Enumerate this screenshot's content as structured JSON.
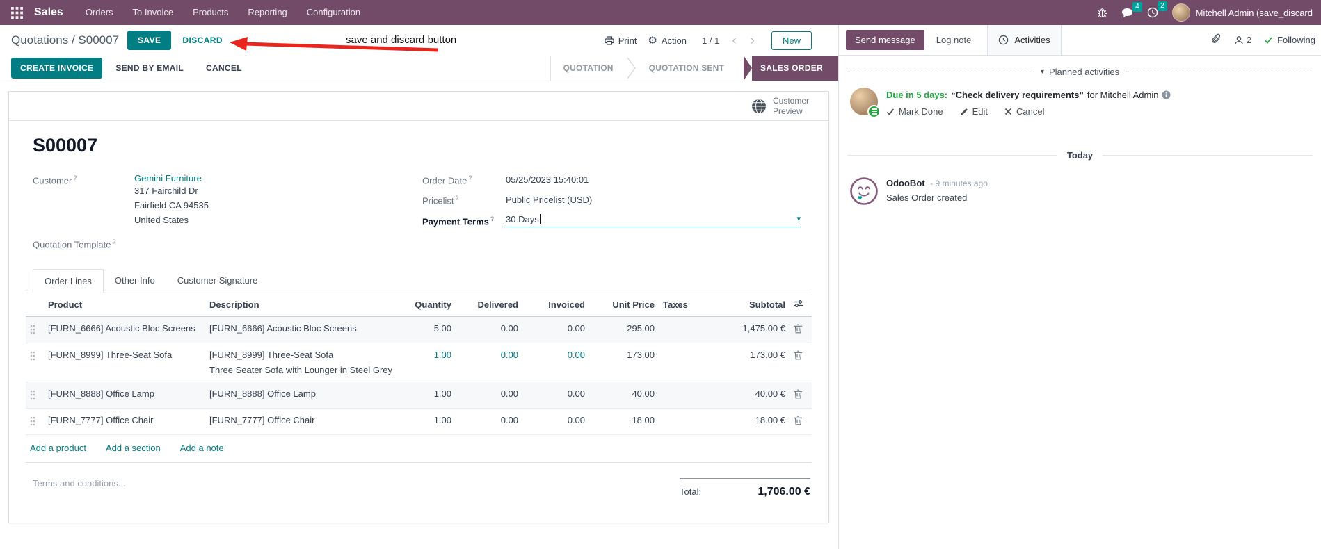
{
  "colors": {
    "brand": "#714B67",
    "accent": "#017E84",
    "badge": "#00A09D",
    "success": "#28a745",
    "arrow_red": "#e8261d"
  },
  "nav": {
    "app": "Sales",
    "items": [
      "Orders",
      "To Invoice",
      "Products",
      "Reporting",
      "Configuration"
    ],
    "badges": {
      "messages": "4",
      "activities": "2"
    },
    "user": "Mitchell Admin (save_discard"
  },
  "control": {
    "breadcrumb_parent": "Quotations",
    "breadcrumb_sep": " / ",
    "breadcrumb_current": "S00007",
    "save": "SAVE",
    "discard": "DISCARD",
    "print": "Print",
    "action": "Action",
    "pager": "1 / 1",
    "prev": "‹",
    "next": "›",
    "new": "New"
  },
  "annotation": {
    "text": "save and discard button"
  },
  "statusbar": {
    "create_invoice": "CREATE INVOICE",
    "send_by_email": "SEND BY EMAIL",
    "cancel": "CANCEL",
    "states": [
      "QUOTATION",
      "QUOTATION SENT"
    ],
    "active_state": "SALES ORDER"
  },
  "sheet": {
    "preview": "Customer Preview",
    "title": "S00007",
    "help": "?",
    "customer_label": "Customer",
    "customer_name": "Gemini Furniture",
    "address_line1": "317 Fairchild Dr",
    "address_line2": "Fairfield CA 94535",
    "address_line3": "United States",
    "quotation_template_label": "Quotation Template",
    "order_date_label": "Order Date",
    "order_date": "05/25/2023 15:40:01",
    "pricelist_label": "Pricelist",
    "pricelist": "Public Pricelist (USD)",
    "payment_terms_label": "Payment Terms",
    "payment_terms": "30 Days",
    "dd_caret": "▾"
  },
  "tabs": [
    {
      "label": "Order Lines",
      "active": true
    },
    {
      "label": "Other Info",
      "active": false
    },
    {
      "label": "Customer Signature",
      "active": false
    }
  ],
  "order_lines": {
    "headers": [
      "Product",
      "Description",
      "Quantity",
      "Delivered",
      "Invoiced",
      "Unit Price",
      "Taxes",
      "Subtotal"
    ],
    "rows": [
      {
        "product": "[FURN_6666] Acoustic Bloc Screens",
        "description": "[FURN_6666] Acoustic Bloc Screens",
        "description2": "",
        "quantity": "5.00",
        "delivered": "0.00",
        "invoiced": "0.00",
        "unit_price": "295.00",
        "taxes": "",
        "subtotal": "1,475.00 €",
        "edited": false,
        "shaded": true
      },
      {
        "product": "[FURN_8999] Three-Seat Sofa",
        "description": "[FURN_8999] Three-Seat Sofa",
        "description2": "Three Seater Sofa with Lounger in Steel Grey Colour",
        "quantity": "1.00",
        "delivered": "0.00",
        "invoiced": "0.00",
        "unit_price": "173.00",
        "taxes": "",
        "subtotal": "173.00 €",
        "edited": true,
        "shaded": false
      },
      {
        "product": "[FURN_8888] Office Lamp",
        "description": "[FURN_8888] Office Lamp",
        "description2": "",
        "quantity": "1.00",
        "delivered": "0.00",
        "invoiced": "0.00",
        "unit_price": "40.00",
        "taxes": "",
        "subtotal": "40.00 €",
        "edited": false,
        "shaded": true
      },
      {
        "product": "[FURN_7777] Office Chair",
        "description": "[FURN_7777] Office Chair",
        "description2": "",
        "quantity": "1.00",
        "delivered": "0.00",
        "invoiced": "0.00",
        "unit_price": "18.00",
        "taxes": "",
        "subtotal": "18.00 €",
        "edited": false,
        "shaded": false
      }
    ],
    "links": [
      "Add a product",
      "Add a section",
      "Add a note"
    ],
    "terms_placeholder": "Terms and conditions...",
    "total_label": "Total:",
    "total": "1,706.00 €"
  },
  "chatter": {
    "send_message": "Send message",
    "log_note": "Log note",
    "activities": "Activities",
    "followers_count": "2",
    "following": "Following",
    "planned_header": "Planned activities",
    "activity": {
      "due": "Due in 5 days:",
      "summary": "“Check delivery requirements”",
      "assignee": "for Mitchell Admin",
      "mark_done": "Mark Done",
      "edit": "Edit",
      "cancel": "Cancel"
    },
    "today": "Today",
    "message": {
      "author": "OdooBot",
      "time": "- 9 minutes ago",
      "body": "Sales Order created"
    }
  }
}
